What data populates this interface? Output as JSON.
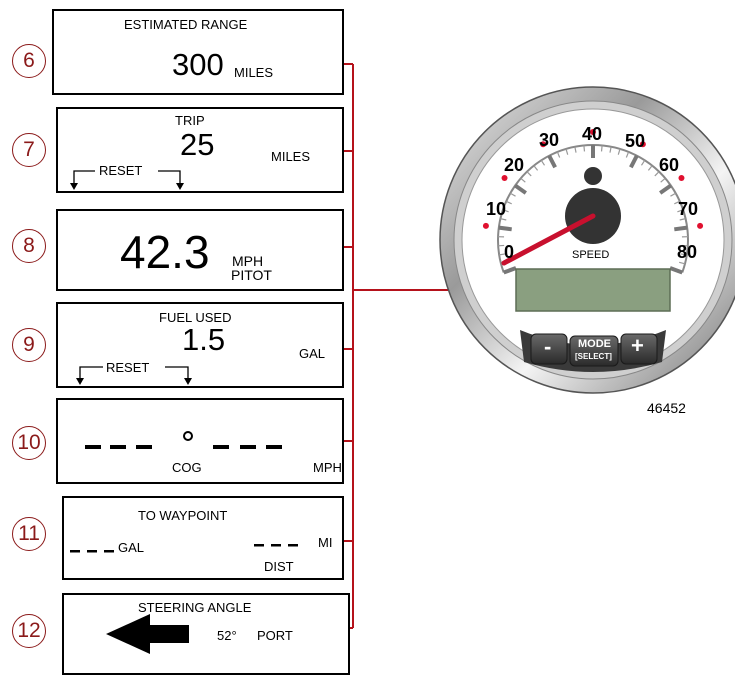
{
  "callouts": [
    "6",
    "7",
    "8",
    "9",
    "10",
    "11",
    "12"
  ],
  "panels": {
    "range": {
      "title": "ESTIMATED RANGE",
      "value": "300",
      "unit": "MILES"
    },
    "trip": {
      "title": "TRIP",
      "value": "25",
      "unit": "MILES",
      "reset": "RESET"
    },
    "speed": {
      "value": "42.3",
      "unit": "MPH",
      "source": "PITOT"
    },
    "fuel": {
      "title": "FUEL USED",
      "value": "1.5",
      "unit": "GAL",
      "reset": "RESET"
    },
    "cog": {
      "label": "COG",
      "unit": "MPH"
    },
    "waypoint": {
      "title": "TO  WAYPOINT",
      "gal": "GAL",
      "mi": "MI",
      "dist": "DIST"
    },
    "steering": {
      "title": "STEERING ANGLE",
      "angle": "52°",
      "dir": "PORT"
    }
  },
  "gauge": {
    "ticks": [
      "0",
      "10",
      "20",
      "30",
      "40",
      "50",
      "60",
      "70",
      "80"
    ],
    "label": "SPEED",
    "buttons": {
      "minus": "-",
      "mode": "MODE",
      "select": "[SELECT]",
      "plus": "+"
    },
    "needle_value": 2
  },
  "figure_number": "46452",
  "colors": {
    "leader": "#b5121b",
    "callout": "#8b1a1a",
    "lcd": "#8a9f80",
    "tick_dot": "#e0102f"
  }
}
